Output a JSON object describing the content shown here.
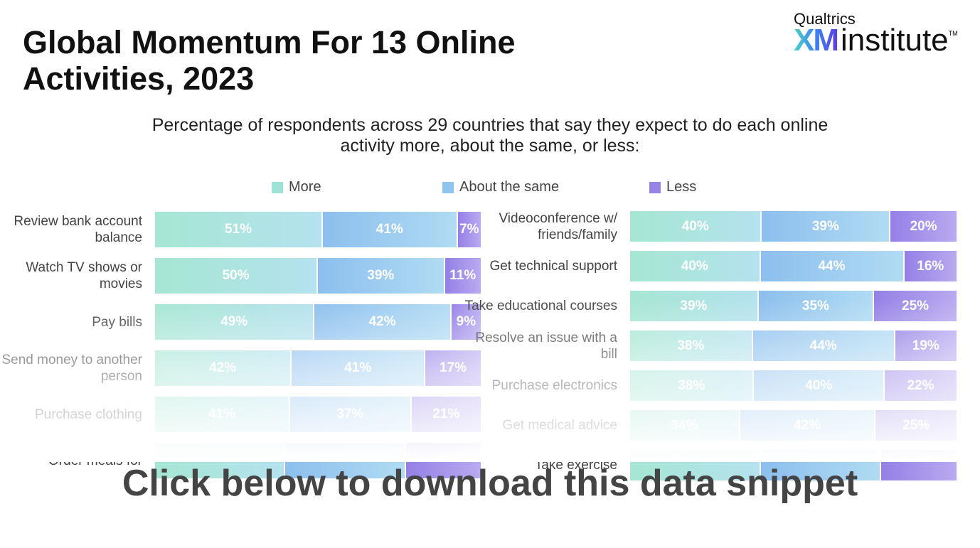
{
  "logo": {
    "line1": "Qualtrics",
    "xm": "XM",
    "institute": "institute",
    "tm": "TM"
  },
  "cta": "Click below to download this data snippet",
  "chart_data": {
    "type": "bar",
    "orientation": "horizontal-stacked",
    "title": "Global Momentum For 13 Online Activities, 2023",
    "subtitle": "Percentage of respondents across 29 countries that say they expect to do each online activity more, about the same, or less:",
    "legend": [
      {
        "name": "More",
        "color": "#9fe3d6"
      },
      {
        "name": "About the same",
        "color": "#8ec4ee"
      },
      {
        "name": "Less",
        "color": "#9784e6"
      }
    ],
    "panels": [
      {
        "categories": [
          "Review bank account balance",
          "Watch TV shows or movies",
          "Pay bills",
          "Send money to another person",
          "Purchase clothing",
          "Order meals for"
        ],
        "series": [
          {
            "name": "More",
            "values": [
              51,
              50,
              49,
              42,
              41,
              null
            ]
          },
          {
            "name": "About the same",
            "values": [
              41,
              39,
              42,
              41,
              37,
              null
            ]
          },
          {
            "name": "Less",
            "values": [
              7,
              11,
              9,
              17,
              21,
              null
            ]
          }
        ]
      },
      {
        "categories": [
          "Videoconference w/ friends/family",
          "Get technical support",
          "Take educational courses",
          "Resolve an issue with a bill",
          "Purchase electronics",
          "Get medical advice",
          "Take exercise"
        ],
        "series": [
          {
            "name": "More",
            "values": [
              40,
              40,
              39,
              38,
              38,
              34,
              null
            ]
          },
          {
            "name": "About the same",
            "values": [
              39,
              44,
              35,
              44,
              40,
              42,
              null
            ]
          },
          {
            "name": "Less",
            "values": [
              20,
              16,
              25,
              19,
              22,
              25,
              null
            ]
          }
        ]
      }
    ]
  }
}
